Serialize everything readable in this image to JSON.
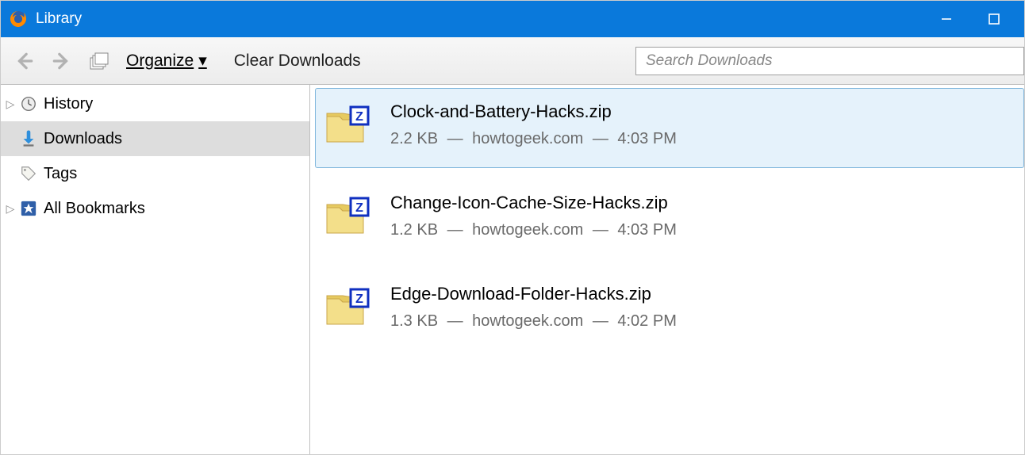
{
  "window": {
    "title": "Library"
  },
  "toolbar": {
    "organize_label": "Organize",
    "clear_label": "Clear Downloads",
    "search_placeholder": "Search Downloads"
  },
  "sidebar": {
    "items": [
      {
        "label": "History",
        "icon": "clock-icon",
        "expandable": true,
        "selected": false
      },
      {
        "label": "Downloads",
        "icon": "download-arrow-icon",
        "expandable": false,
        "selected": true
      },
      {
        "label": "Tags",
        "icon": "tag-icon",
        "expandable": false,
        "selected": false
      },
      {
        "label": "All Bookmarks",
        "icon": "star-box-icon",
        "expandable": true,
        "selected": false
      }
    ]
  },
  "downloads": [
    {
      "filename": "Clock-and-Battery-Hacks.zip",
      "size": "2.2 KB",
      "host": "howtogeek.com",
      "time": "4:03 PM",
      "selected": true
    },
    {
      "filename": "Change-Icon-Cache-Size-Hacks.zip",
      "size": "1.2 KB",
      "host": "howtogeek.com",
      "time": "4:03 PM",
      "selected": false
    },
    {
      "filename": "Edge-Download-Folder-Hacks.zip",
      "size": "1.3 KB",
      "host": "howtogeek.com",
      "time": "4:02 PM",
      "selected": false
    }
  ],
  "meta_sep": "—"
}
